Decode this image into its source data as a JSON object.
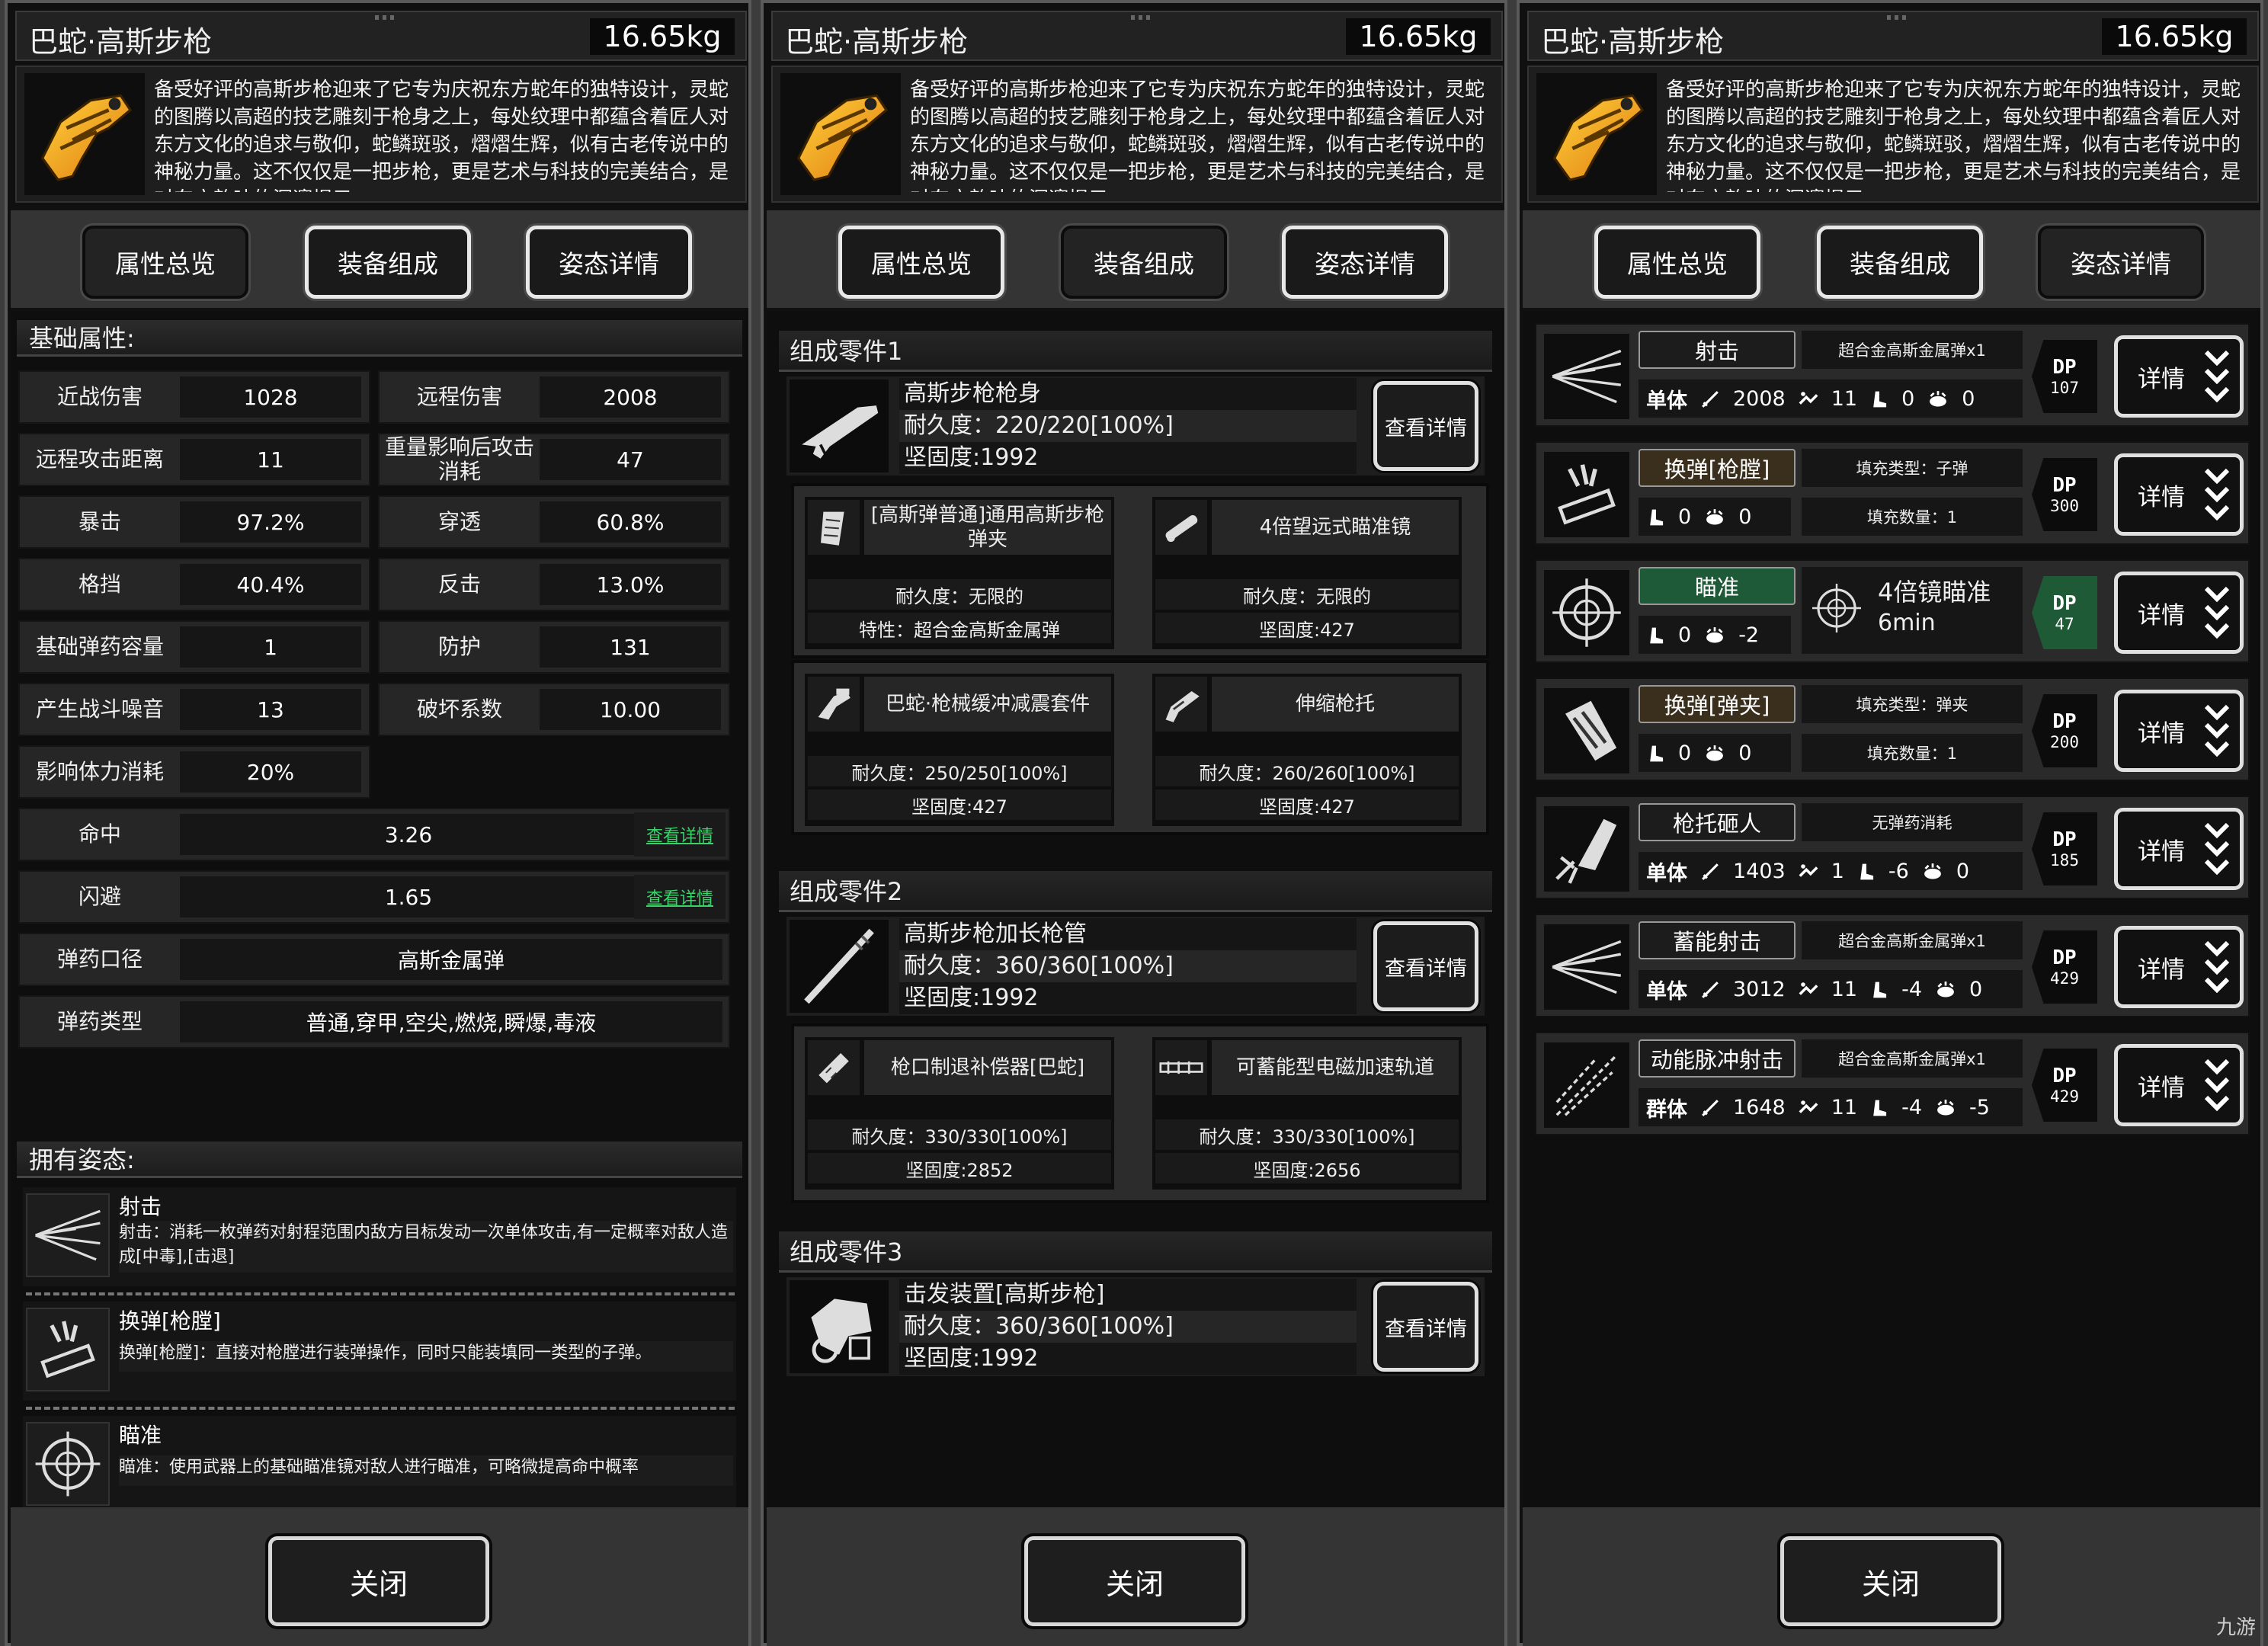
{
  "weapon": {
    "name": "巴蛇·高斯步枪",
    "weight": "16.65kg",
    "description": "备受好评的高斯步枪迎来了它专为庆祝东方蛇年的独特设计，灵蛇的图腾以高超的技艺雕刻于枪身之上，每处纹理中都蕴含着匠人对东方文化的追求与敬仰，蛇鳞斑驳，熠熠生辉，似有古老传说中的神秘力量。这不仅仅是一把步枪，更是艺术与科技的完美结合，是对东方韵味的深邃揭示。"
  },
  "tabs": [
    "属性总览",
    "装备组成",
    "姿态详情"
  ],
  "close_label": "关闭",
  "panel1": {
    "basic_header": "基础属性:",
    "stats": [
      {
        "label": "近战伤害",
        "value": "1028"
      },
      {
        "label": "远程伤害",
        "value": "2008"
      },
      {
        "label": "远程攻击距离",
        "value": "11"
      },
      {
        "label": "重量影响后攻击消耗",
        "value": "47"
      },
      {
        "label": "暴击",
        "value": "97.2%"
      },
      {
        "label": "穿透",
        "value": "60.8%"
      },
      {
        "label": "格挡",
        "value": "40.4%"
      },
      {
        "label": "反击",
        "value": "13.0%"
      },
      {
        "label": "基础弹药容量",
        "value": "1"
      },
      {
        "label": "防护",
        "value": "131"
      },
      {
        "label": "产生战斗噪音",
        "value": "13"
      },
      {
        "label": "破坏系数",
        "value": "10.00"
      },
      {
        "label": "影响体力消耗",
        "value": "20%"
      }
    ],
    "wide_stats": [
      {
        "label": "命中",
        "value": "3.26",
        "link": "查看详情"
      },
      {
        "label": "闪避",
        "value": "1.65",
        "link": "查看详情"
      },
      {
        "label": "弹药口径",
        "value": "高斯金属弹"
      },
      {
        "label": "弹药类型",
        "value": "普通,穿甲,空尖,燃烧,瞬爆,毒液"
      }
    ],
    "poses_header": "拥有姿态:",
    "poses": [
      {
        "name": "射击",
        "desc": "射击：消耗一枚弹药对射程范围内敌方目标发动一次单体攻击,有一定概率对敌人造成[中毒],[击退]"
      },
      {
        "name": "换弹[枪膛]",
        "desc": "换弹[枪膛]：直接对枪膛进行装弹操作，同时只能装填同一类型的子弹。"
      },
      {
        "name": "瞄准",
        "desc": "瞄准：使用武器上的基础瞄准镜对敌人进行瞄准，可略微提高命中概率"
      }
    ]
  },
  "panel2": {
    "view_label": "查看详情",
    "parts": [
      {
        "header": "组成零件1",
        "name": "高斯步枪枪身",
        "durability": "耐久度：220/220[100%]",
        "hardness": "坚固度:1992",
        "subs": [
          {
            "name": "[高斯弹普通]通用高斯步枪弹夹",
            "r1": "耐久度：无限的",
            "r2": "特性：超合金高斯金属弹"
          },
          {
            "name": "4倍望远式瞄准镜",
            "r1": "耐久度：无限的",
            "r2": "坚固度:427"
          },
          {
            "name": "巴蛇·枪械缓冲减震套件",
            "r1": "耐久度：250/250[100%]",
            "r2": "坚固度:427"
          },
          {
            "name": "伸缩枪托",
            "r1": "耐久度：260/260[100%]",
            "r2": "坚固度:427"
          }
        ]
      },
      {
        "header": "组成零件2",
        "name": "高斯步枪加长枪管",
        "durability": "耐久度：360/360[100%]",
        "hardness": "坚固度:1992",
        "subs": [
          {
            "name": "枪口制退补偿器[巴蛇]",
            "r1": "耐久度：330/330[100%]",
            "r2": "坚固度:2852"
          },
          {
            "name": "可蓄能型电磁加速轨道",
            "r1": "耐久度：330/330[100%]",
            "r2": "坚固度:2656"
          }
        ]
      },
      {
        "header": "组成零件3",
        "name": "击发装置[高斯步枪]",
        "durability": "耐久度：360/360[100%]",
        "hardness": "坚固度:1992"
      }
    ]
  },
  "panel3": {
    "detail_label": "详情",
    "skills": [
      {
        "name": "射击",
        "style": "normal",
        "ammo": "超合金高斯金属弹x1",
        "target": "单体",
        "dmg": "2008",
        "acc": "11",
        "stam": "0",
        "noise": "0",
        "dp": "107"
      },
      {
        "name": "换弹[枪膛]",
        "style": "reload",
        "fill_type": "填充类型：子弹",
        "fill_count": "填充数量：1",
        "stam": "0",
        "noise": "0",
        "dp": "300"
      },
      {
        "name": "瞄准",
        "style": "aim",
        "scope": "4倍镜瞄准",
        "time": "6min",
        "stam": "0",
        "noise": "-2",
        "dp": "47"
      },
      {
        "name": "换弹[弹夹]",
        "style": "reload",
        "fill_type": "填充类型：弹夹",
        "fill_count": "填充数量：1",
        "stam": "0",
        "noise": "0",
        "dp": "200"
      },
      {
        "name": "枪托砸人",
        "style": "normal",
        "ammo": "无弹药消耗",
        "target": "单体",
        "dmg": "1403",
        "acc": "1",
        "stam": "-6",
        "noise": "0",
        "dp": "185"
      },
      {
        "name": "蓄能射击",
        "style": "normal",
        "ammo": "超合金高斯金属弹x1",
        "target": "单体",
        "dmg": "3012",
        "acc": "11",
        "stam": "-4",
        "noise": "0",
        "dp": "429"
      },
      {
        "name": "动能脉冲射击",
        "style": "normal",
        "ammo": "超合金高斯金属弹x1",
        "target": "群体",
        "dmg": "1648",
        "acc": "11",
        "stam": "-4",
        "noise": "-5",
        "dp": "429"
      }
    ]
  },
  "dp_label": "DP",
  "watermark": "九游"
}
